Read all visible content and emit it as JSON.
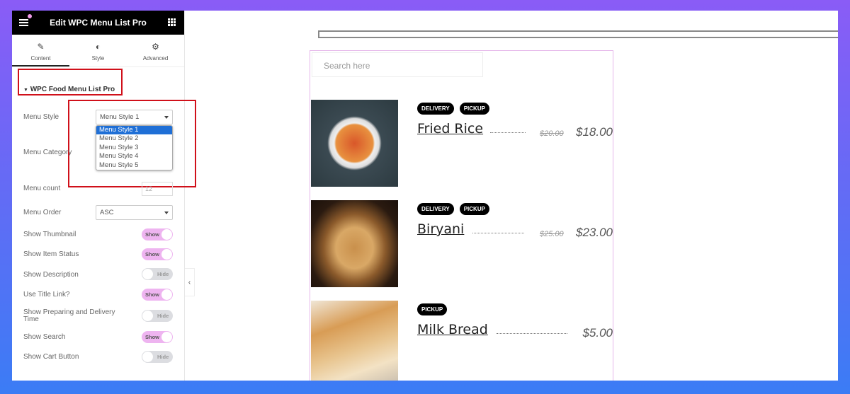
{
  "panel": {
    "title": "Edit WPC Menu List Pro",
    "tabs": [
      {
        "label": "Content",
        "icon": "pencil-icon"
      },
      {
        "label": "Style",
        "icon": "contrast-icon"
      },
      {
        "label": "Advanced",
        "icon": "gear-icon"
      }
    ],
    "section_title": "WPC Food Menu List Pro",
    "menu_style": {
      "label": "Menu Style",
      "value": "Menu Style 1",
      "options": [
        "Menu Style 1",
        "Menu Style 2",
        "Menu Style 3",
        "Menu Style 4",
        "Menu Style 5"
      ]
    },
    "menu_category": {
      "label": "Menu Category"
    },
    "menu_count": {
      "label": "Menu count",
      "value": "12"
    },
    "menu_order": {
      "label": "Menu Order",
      "value": "ASC"
    },
    "toggles": [
      {
        "label": "Show Thumbnail",
        "state": "Show",
        "on": true
      },
      {
        "label": "Show Item Status",
        "state": "Show",
        "on": true
      },
      {
        "label": "Show Description",
        "state": "Hide",
        "on": false
      },
      {
        "label": "Use Title Link?",
        "state": "Show",
        "on": true
      },
      {
        "label": "Show Preparing and Delivery Time",
        "state": "Hide",
        "on": false
      },
      {
        "label": "Show Search",
        "state": "Show",
        "on": true
      },
      {
        "label": "Show Cart Button",
        "state": "Hide",
        "on": false
      }
    ]
  },
  "preview": {
    "search_placeholder": "Search here",
    "items": [
      {
        "title": "Fried Rice",
        "badges": [
          "DELIVERY",
          "PICKUP"
        ],
        "old_price": "$20.00",
        "price": "$18.00"
      },
      {
        "title": "Biryani",
        "badges": [
          "DELIVERY",
          "PICKUP"
        ],
        "old_price": "$25.00",
        "price": "$23.00"
      },
      {
        "title": "Milk Bread",
        "badges": [
          "PICKUP"
        ],
        "old_price": "",
        "price": "$5.00"
      }
    ]
  },
  "colors": {
    "toggle_on": "#eeb4f0",
    "highlight": "#d0101a",
    "selected_option": "#1f6fd6"
  }
}
